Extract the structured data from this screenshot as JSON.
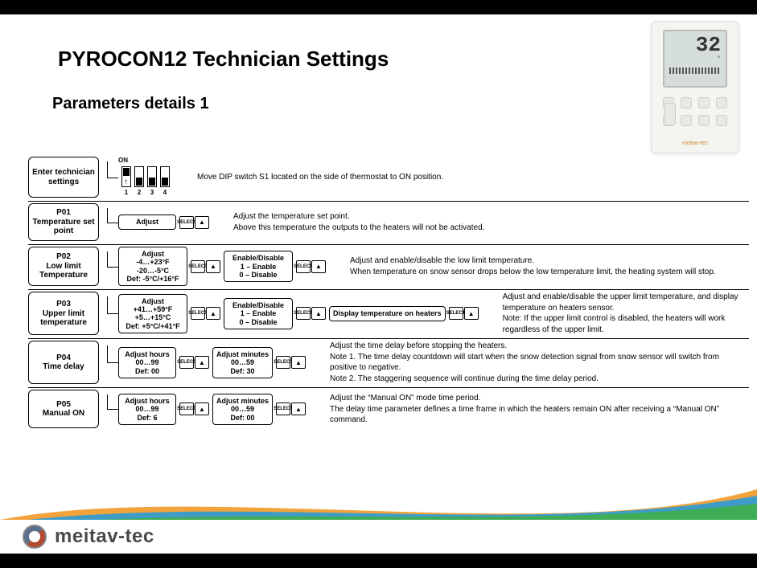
{
  "title": "PYROCON12 Technician Settings",
  "subtitle": "Parameters details 1",
  "device": {
    "temp": "32",
    "unit": "°",
    "brand": "meitav-tec"
  },
  "dip": {
    "on_label": "ON",
    "numbers": [
      "1",
      "2",
      "3",
      "4"
    ]
  },
  "select_label": "SELECT",
  "rows": [
    {
      "label": "Enter technician settings",
      "desc": "Move DIP switch S1 located on the side of thermostat to ON position."
    },
    {
      "code": "P01",
      "label": "Temperature set point",
      "steps": [
        {
          "text": "Adjust"
        }
      ],
      "desc": "Adjust the temperature set point.\nAbove this temperature the outputs to the heaters will not be activated."
    },
    {
      "code": "P02",
      "label": "Low limit Temperature",
      "steps": [
        {
          "text": "Adjust\n-4…+23°F\n-20…-5°C\nDef: -5°C/+16°F"
        },
        {
          "text": "Enable/Disable\n1 – Enable\n0 – Disable"
        }
      ],
      "desc": "Adjust and enable/disable the low limit temperature.\nWhen temperature on snow sensor drops below the low temperature limit, the heating system will stop."
    },
    {
      "code": "P03",
      "label": "Upper limit temperature",
      "steps": [
        {
          "text": "Adjust\n+41…+59°F\n+5…+15°C\nDef: +5°C/+41°F"
        },
        {
          "text": "Enable/Disable\n1 – Enable\n0 – Disable"
        },
        {
          "text": "Display temperature on heaters"
        }
      ],
      "desc": "Adjust and enable/disable the upper limit temperature, and display temperature on heaters sensor.\nNote: If the upper limit control is disabled, the heaters will work regardless of the upper limit."
    },
    {
      "code": "P04",
      "label": "Time delay",
      "steps": [
        {
          "text": "Adjust hours\n00…99\nDef: 00"
        },
        {
          "text": "Adjust minutes\n00…59\nDef: 30"
        }
      ],
      "desc": "Adjust the time delay before stopping the heaters.\nNote 1. The time delay countdown will start when the snow detection signal from snow sensor will switch from positive to negative.\nNote 2. The staggering sequence will continue during the time delay period."
    },
    {
      "code": "P05",
      "label": "Manual ON",
      "steps": [
        {
          "text": "Adjust hours\n00…99\nDef: 6"
        },
        {
          "text": "Adjust minutes\n00…59\nDef: 00"
        }
      ],
      "desc": "Adjust  the “Manual ON” mode time period.\nThe delay time parameter defines a time frame in which the heaters remain ON after receiving a “Manual ON” command."
    }
  ],
  "footer_brand": "meitav-tec"
}
